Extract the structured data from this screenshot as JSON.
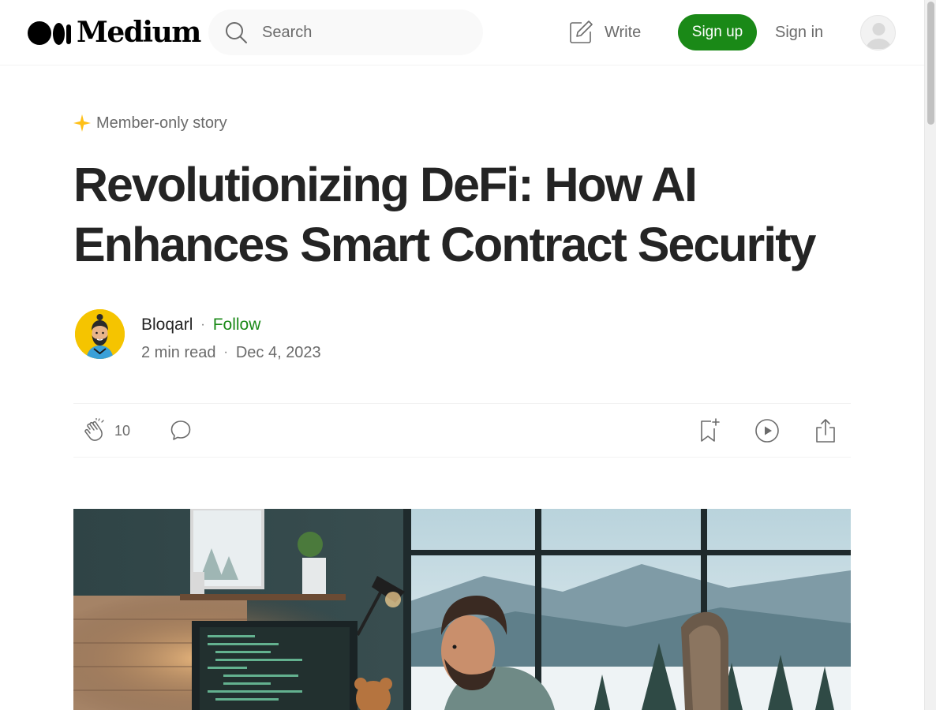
{
  "header": {
    "logo_text": "Medium",
    "search_placeholder": "Search",
    "write_label": "Write",
    "signup_label": "Sign up",
    "signin_label": "Sign in"
  },
  "article": {
    "member_label": "Member-only story",
    "title": "Revolutionizing DeFi: How AI Enhances Smart Contract Security",
    "author": "Bloqarl",
    "follow_label": "Follow",
    "separator": "·",
    "read_time": "2 min read",
    "date": "Dec 4, 2023",
    "clap_count": "10"
  },
  "colors": {
    "brand_green": "#1a8917",
    "member_star": "#ffc017",
    "text_primary": "#242424",
    "text_secondary": "#6b6b6b"
  },
  "icons": [
    "search-icon",
    "write-icon",
    "user-icon",
    "star-icon",
    "clap-icon",
    "comment-icon",
    "bookmark-icon",
    "play-icon",
    "share-icon"
  ]
}
